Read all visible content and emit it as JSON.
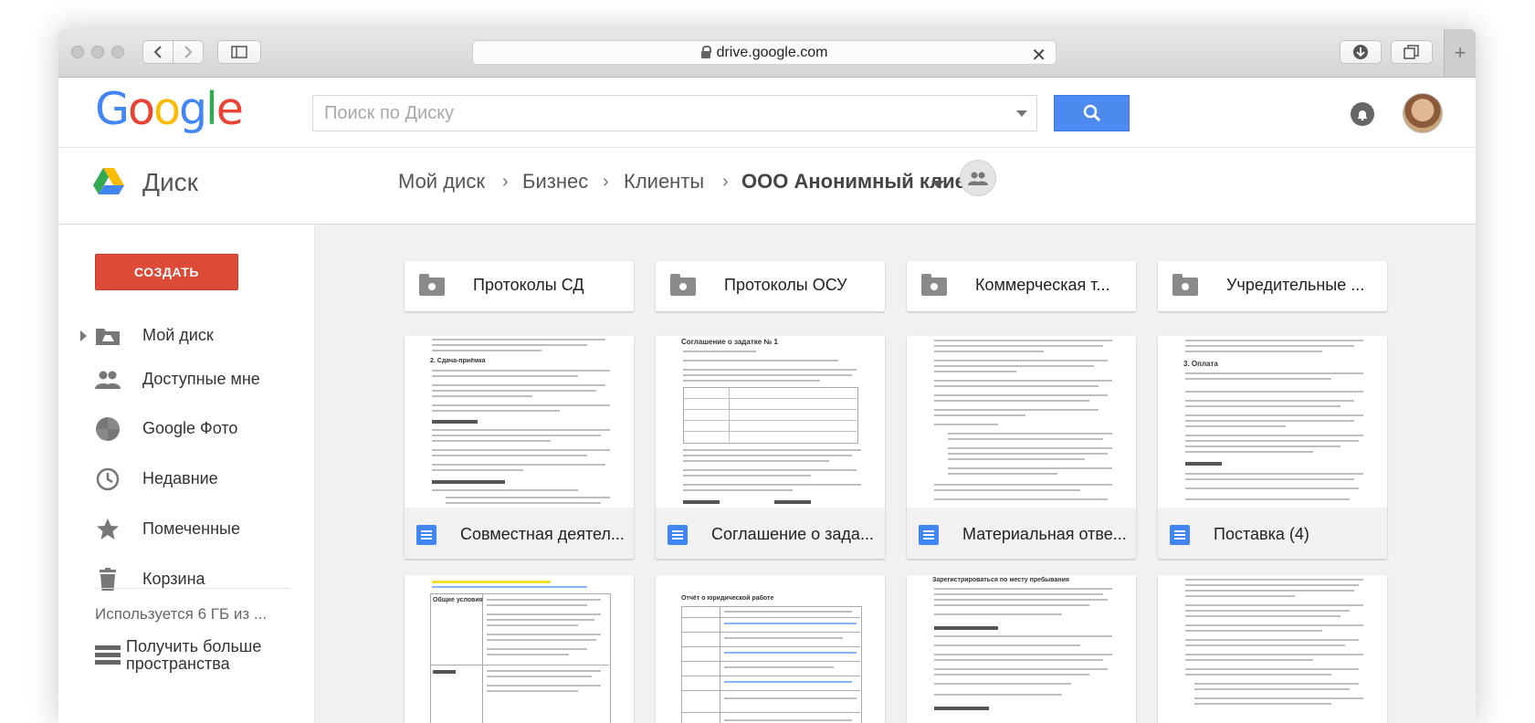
{
  "browser": {
    "url": "drive.google.com"
  },
  "header": {
    "logo": [
      "G",
      "o",
      "o",
      "g",
      "l",
      "e"
    ],
    "logo_colors": [
      "#4285f4",
      "#ea4335",
      "#fbbc05",
      "#4285f4",
      "#34a853",
      "#ea4335"
    ],
    "search_placeholder": "Поиск по Диску",
    "accent": "#4d8af0"
  },
  "drive": {
    "title": "Диск",
    "breadcrumb": [
      "Мой диск",
      "Бизнес",
      "Клиенты",
      "ООО Анонимный клиент"
    ]
  },
  "sidebar": {
    "create_label": "СОЗДАТЬ",
    "items": [
      {
        "label": "Мой диск",
        "icon": "drive-icon"
      },
      {
        "label": "Доступные мне",
        "icon": "people-icon"
      },
      {
        "label": "Google Фото",
        "icon": "photos-icon"
      },
      {
        "label": "Недавние",
        "icon": "clock-icon"
      },
      {
        "label": "Помеченные",
        "icon": "star-icon"
      },
      {
        "label": "Корзина",
        "icon": "trash-icon"
      }
    ],
    "storage_text": "Используется 6 ГБ из ...",
    "more_storage_label": "Получить больше пространства"
  },
  "folders": [
    {
      "name": "Протоколы СД"
    },
    {
      "name": "Протоколы ОСУ"
    },
    {
      "name": "Коммерческая т..."
    },
    {
      "name": "Учредительные ..."
    }
  ],
  "files": [
    {
      "name": "Совместная деятел...",
      "thumb_title": "2. Сдача-приёмка"
    },
    {
      "name": "Соглашение о зада...",
      "thumb_title": "Соглашение о задатке № 1"
    },
    {
      "name": "Материальная отве...",
      "thumb_title": ""
    },
    {
      "name": "Поставка (4)",
      "thumb_title": "3. Оплата"
    }
  ],
  "files_row2": [
    {
      "thumb_title": "Общие условия"
    },
    {
      "thumb_title": "Отчёт о юридической работе"
    },
    {
      "thumb_title": "Зарегистрироваться по месту пребывания"
    },
    {
      "thumb_title": ""
    }
  ]
}
